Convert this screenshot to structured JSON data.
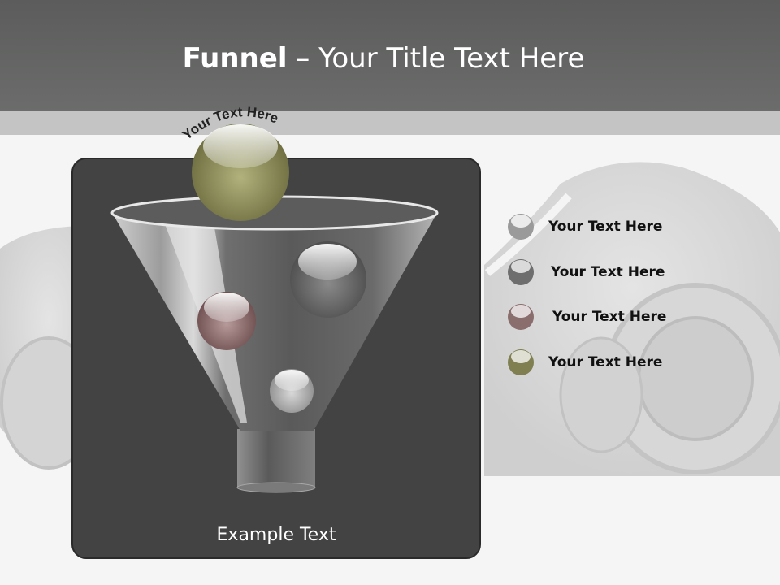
{
  "slide": {
    "title_bold": "Funnel",
    "title_rest": " – Your Title Text Here",
    "arc_text": "Your Text Here",
    "panel_caption": "Example Text"
  },
  "legend": [
    {
      "label": "Your  Text Here",
      "color": "#9a9a9a",
      "icon": "ball-icon-silver"
    },
    {
      "label": "Your  Text Here",
      "color": "#6e6e6e",
      "icon": "ball-icon-gray"
    },
    {
      "label": "Your  Text Here",
      "color": "#8a6e6e",
      "icon": "ball-icon-rose"
    },
    {
      "label": "Your  Text Here",
      "color": "#7f7f52",
      "icon": "ball-icon-olive"
    }
  ],
  "colors": {
    "header": "#636463",
    "band": "#c4c4c4",
    "panel": "#434343",
    "olive_ball": "#7f7f52",
    "rose_ball": "#8a6e6e"
  }
}
